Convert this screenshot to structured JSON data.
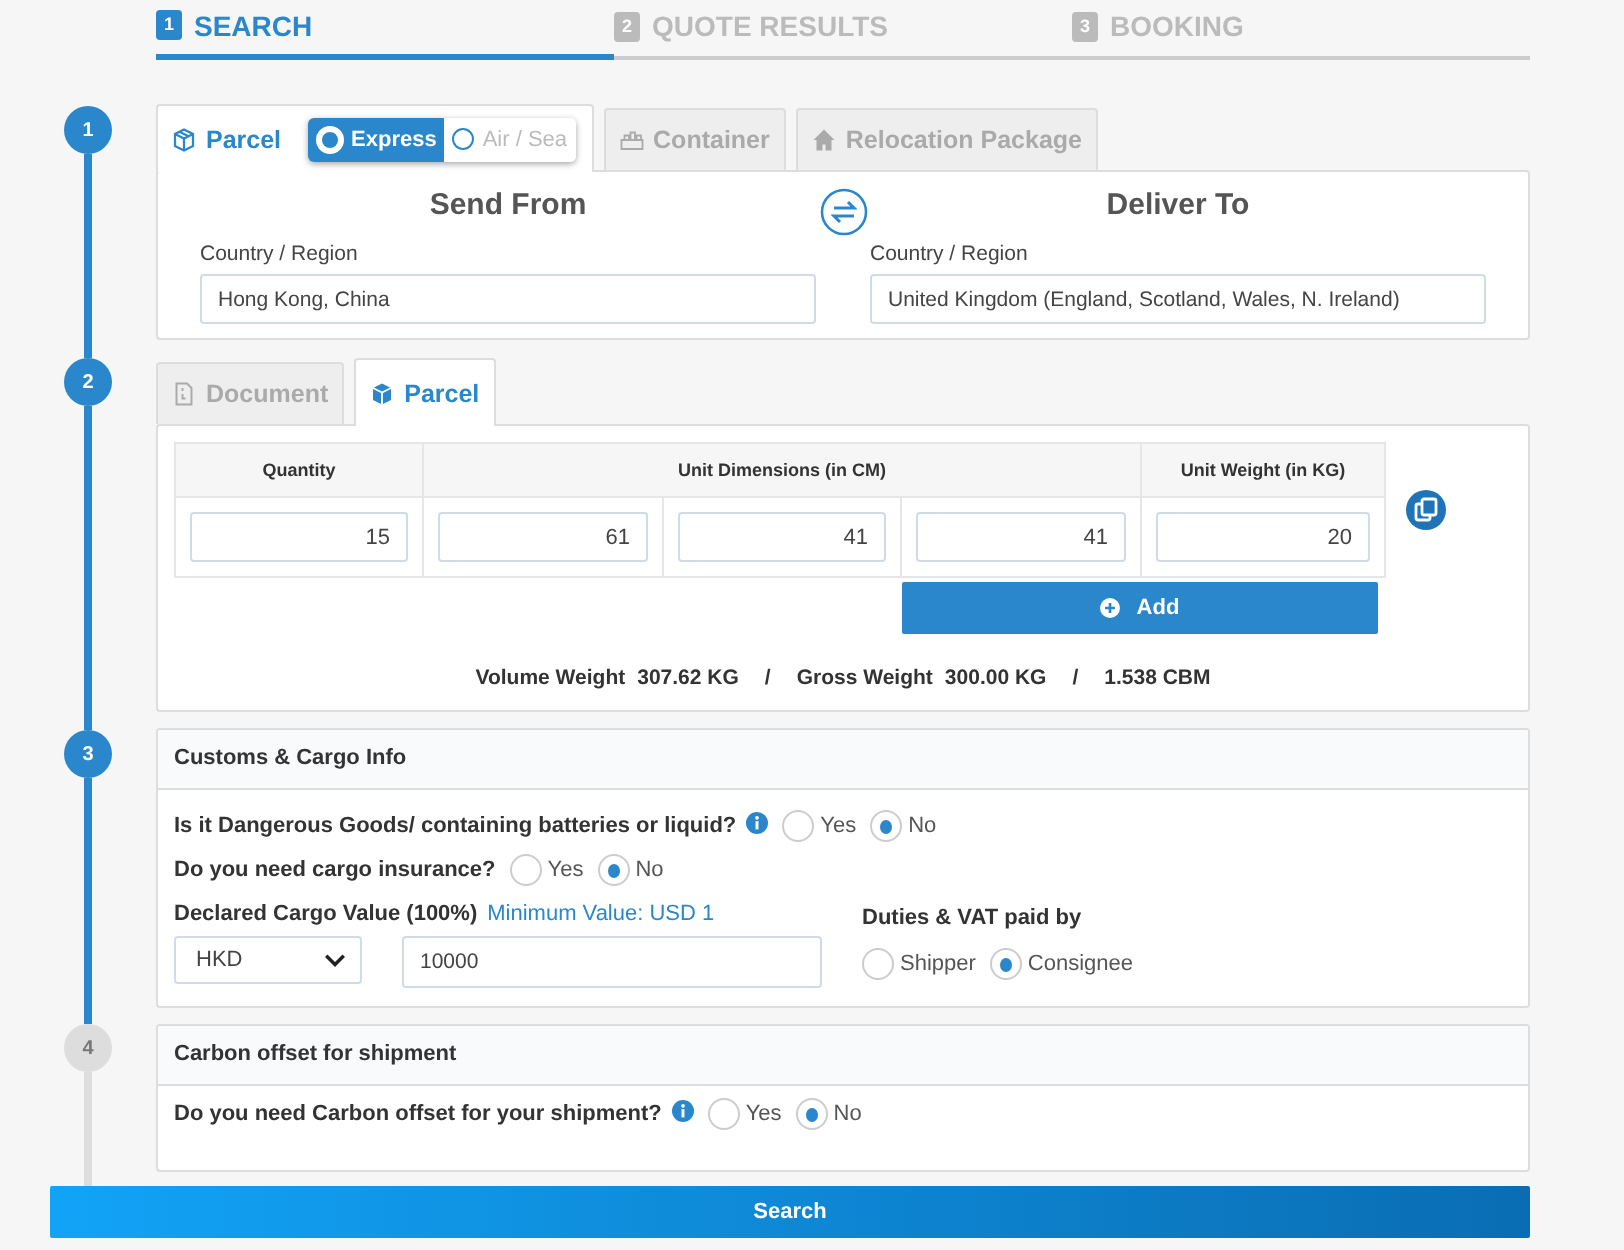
{
  "steps_bar": [
    {
      "number": "1",
      "label": "SEARCH",
      "selected": true
    },
    {
      "number": "2",
      "label": "QUOTE RESULTS",
      "selected": false
    },
    {
      "number": "3",
      "label": "BOOKING",
      "selected": false
    }
  ],
  "timeline": [
    {
      "number": "1",
      "done": true
    },
    {
      "number": "2",
      "done": true
    },
    {
      "number": "3",
      "done": true
    },
    {
      "number": "4",
      "done": false
    }
  ],
  "shipment_tabs": [
    {
      "kind": "parcel",
      "label": "Parcel",
      "selected": true
    },
    {
      "kind": "container",
      "label": "Container",
      "selected": false
    },
    {
      "kind": "relocation",
      "label": "Relocation Package",
      "selected": false
    }
  ],
  "service_toggle": [
    {
      "label": "Express",
      "selected": true
    },
    {
      "label": "Air / Sea",
      "selected": false
    }
  ],
  "route": {
    "from": {
      "heading": "Send From",
      "label": "Country / Region",
      "value": "Hong Kong, China"
    },
    "to": {
      "heading": "Deliver To",
      "label": "Country / Region",
      "value": "United Kingdom (England, Scotland, Wales, N. Ireland)"
    }
  },
  "package_tabs": [
    {
      "kind": "document",
      "label": "Document",
      "selected": false
    },
    {
      "kind": "parcel",
      "label": "Parcel",
      "selected": true
    }
  ],
  "dimensions_table": {
    "headers": [
      "Quantity",
      "Unit Dimensions (in CM)",
      "Unit Weight (in KG)"
    ],
    "values": [
      "15",
      "61",
      "41",
      "41",
      "20"
    ]
  },
  "add_button": "Add",
  "totals": {
    "volume_label": "Volume Weight",
    "volume_value": "307.62 KG",
    "gross_label": "Gross Weight",
    "gross_value": "300.00 KG",
    "cbm": "1.538 CBM",
    "separator": "/"
  },
  "customs": {
    "title": "Customs & Cargo Info",
    "questions": [
      {
        "text": "Is it Dangerous Goods/ containing batteries or liquid?",
        "info": true,
        "options": [
          {
            "label": "Yes",
            "selected": false
          },
          {
            "label": "No",
            "selected": true
          }
        ]
      },
      {
        "text": "Do you need cargo insurance?",
        "info": false,
        "options": [
          {
            "label": "Yes",
            "selected": false
          },
          {
            "label": "No",
            "selected": true
          }
        ]
      }
    ],
    "declared": {
      "label": "Declared Cargo Value (100%)",
      "hint": "Minimum Value: USD 1",
      "currency": "HKD",
      "value": "10000"
    },
    "duties": {
      "label": "Duties & VAT paid by",
      "options": [
        {
          "label": "Shipper",
          "selected": false
        },
        {
          "label": "Consignee",
          "selected": true
        }
      ]
    }
  },
  "carbon": {
    "title": "Carbon offset for shipment",
    "question": {
      "text": "Do you need Carbon offset for your shipment?",
      "info": true,
      "options": [
        {
          "label": "Yes",
          "selected": false
        },
        {
          "label": "No",
          "selected": true
        }
      ]
    }
  },
  "search_button": "Search"
}
